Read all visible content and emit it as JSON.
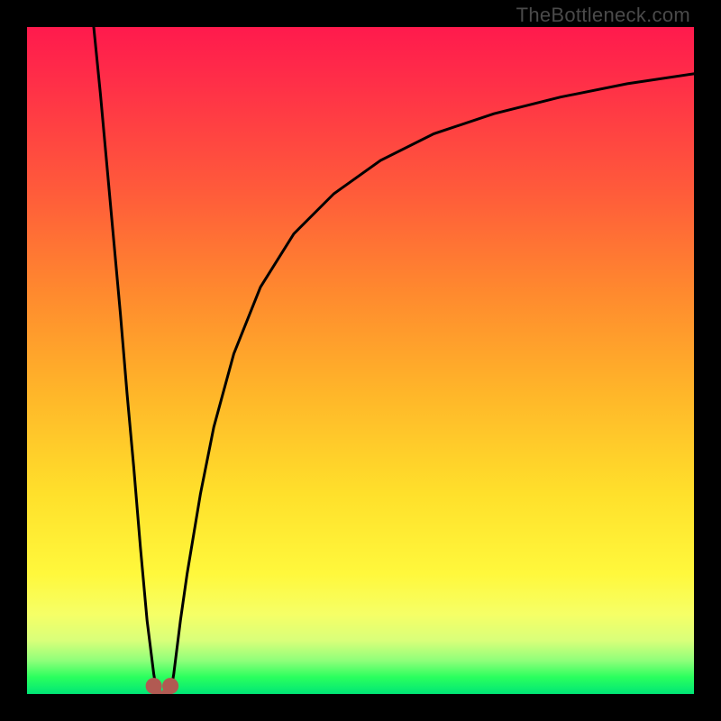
{
  "watermark": "TheBottleneck.com",
  "chart_data": {
    "type": "line",
    "title": "",
    "xlabel": "",
    "ylabel": "",
    "xlim": [
      0,
      100
    ],
    "ylim": [
      0,
      100
    ],
    "grid": false,
    "series": [
      {
        "name": "left-branch",
        "x": [
          10,
          11,
          12,
          13,
          14,
          15,
          16,
          17,
          18,
          19,
          19.5
        ],
        "values": [
          100,
          90,
          79,
          68,
          57,
          45,
          34,
          22,
          11,
          3,
          0
        ]
      },
      {
        "name": "right-branch",
        "x": [
          21.5,
          22,
          23,
          24,
          26,
          28,
          31,
          35,
          40,
          46,
          53,
          61,
          70,
          80,
          90,
          100
        ],
        "values": [
          0,
          3,
          11,
          18,
          30,
          40,
          51,
          61,
          69,
          75,
          80,
          84,
          87,
          89.5,
          91.5,
          93
        ]
      }
    ],
    "markers": [
      {
        "name": "trough-left",
        "x": 19.0,
        "y": 1.2,
        "color": "#b15a52",
        "size": 9
      },
      {
        "name": "trough-right",
        "x": 21.5,
        "y": 1.2,
        "color": "#b15a52",
        "size": 9
      },
      {
        "name": "trough-bridge-a",
        "x": 19.6,
        "y": 0.2,
        "color": "#b15a52",
        "size": 5
      },
      {
        "name": "trough-bridge-b",
        "x": 20.9,
        "y": 0.2,
        "color": "#b15a52",
        "size": 5
      }
    ],
    "background": {
      "type": "vertical-gradient",
      "stops": [
        {
          "pos": 0.0,
          "color": "#ff1a4d"
        },
        {
          "pos": 0.25,
          "color": "#ff5c3a"
        },
        {
          "pos": 0.55,
          "color": "#ffb629"
        },
        {
          "pos": 0.82,
          "color": "#fff83c"
        },
        {
          "pos": 0.95,
          "color": "#8fff7a"
        },
        {
          "pos": 1.0,
          "color": "#00e676"
        }
      ]
    }
  }
}
